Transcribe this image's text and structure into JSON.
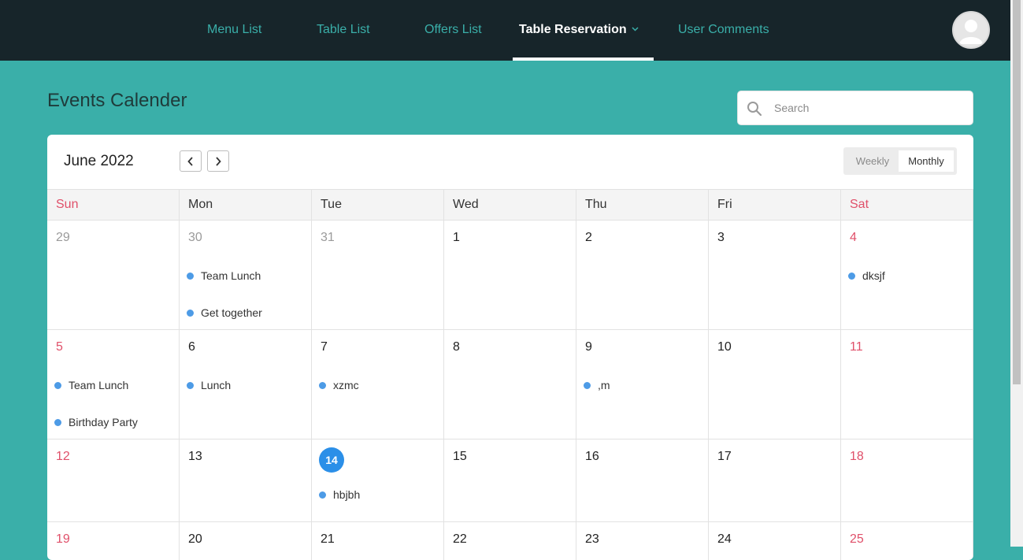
{
  "nav": {
    "items": [
      {
        "label": "Menu List"
      },
      {
        "label": "Table List"
      },
      {
        "label": "Offers List"
      },
      {
        "label": "Table Reservation"
      },
      {
        "label": "User Comments"
      }
    ],
    "active_index": 3,
    "avatar_icon": "user-avatar-icon"
  },
  "page": {
    "title": "Events Calender",
    "search_placeholder": "Search"
  },
  "calendar": {
    "month_label": "June 2022",
    "prev_icon": "chevron-left-icon",
    "next_icon": "chevron-right-icon",
    "views": [
      {
        "label": "Weekly"
      },
      {
        "label": "Monthly"
      }
    ],
    "active_view": "Monthly",
    "weekdays": [
      "Sun",
      "Mon",
      "Tue",
      "Wed",
      "Thu",
      "Fri",
      "Sat"
    ],
    "weeks": [
      [
        {
          "day": "29",
          "muted": true,
          "events": []
        },
        {
          "day": "30",
          "muted": true,
          "events": [
            "Team Lunch",
            "Get together"
          ]
        },
        {
          "day": "31",
          "muted": true,
          "events": []
        },
        {
          "day": "1",
          "events": []
        },
        {
          "day": "2",
          "events": []
        },
        {
          "day": "3",
          "events": []
        },
        {
          "day": "4",
          "events": [
            "dksjf"
          ]
        }
      ],
      [
        {
          "day": "5",
          "events": [
            "Team Lunch",
            "Birthday Party"
          ]
        },
        {
          "day": "6",
          "events": [
            "Lunch"
          ]
        },
        {
          "day": "7",
          "events": [
            "xzmc"
          ]
        },
        {
          "day": "8",
          "events": []
        },
        {
          "day": "9",
          "events": [
            ",m"
          ]
        },
        {
          "day": "10",
          "events": []
        },
        {
          "day": "11",
          "events": []
        }
      ],
      [
        {
          "day": "12",
          "events": []
        },
        {
          "day": "13",
          "events": []
        },
        {
          "day": "14",
          "today": true,
          "events": [
            "hbjbh"
          ]
        },
        {
          "day": "15",
          "events": []
        },
        {
          "day": "16",
          "events": []
        },
        {
          "day": "17",
          "events": []
        },
        {
          "day": "18",
          "events": []
        }
      ],
      [
        {
          "day": "19",
          "events": []
        },
        {
          "day": "20",
          "events": []
        },
        {
          "day": "21",
          "events": []
        },
        {
          "day": "22",
          "events": []
        },
        {
          "day": "23",
          "events": []
        },
        {
          "day": "24",
          "events": []
        },
        {
          "day": "25",
          "events": []
        }
      ]
    ]
  },
  "colors": {
    "accent": "#3aafa9",
    "navbar": "#17252a",
    "weekend": "#e0506a",
    "today": "#2b8fe8",
    "event_dot": "#4d9be6"
  }
}
